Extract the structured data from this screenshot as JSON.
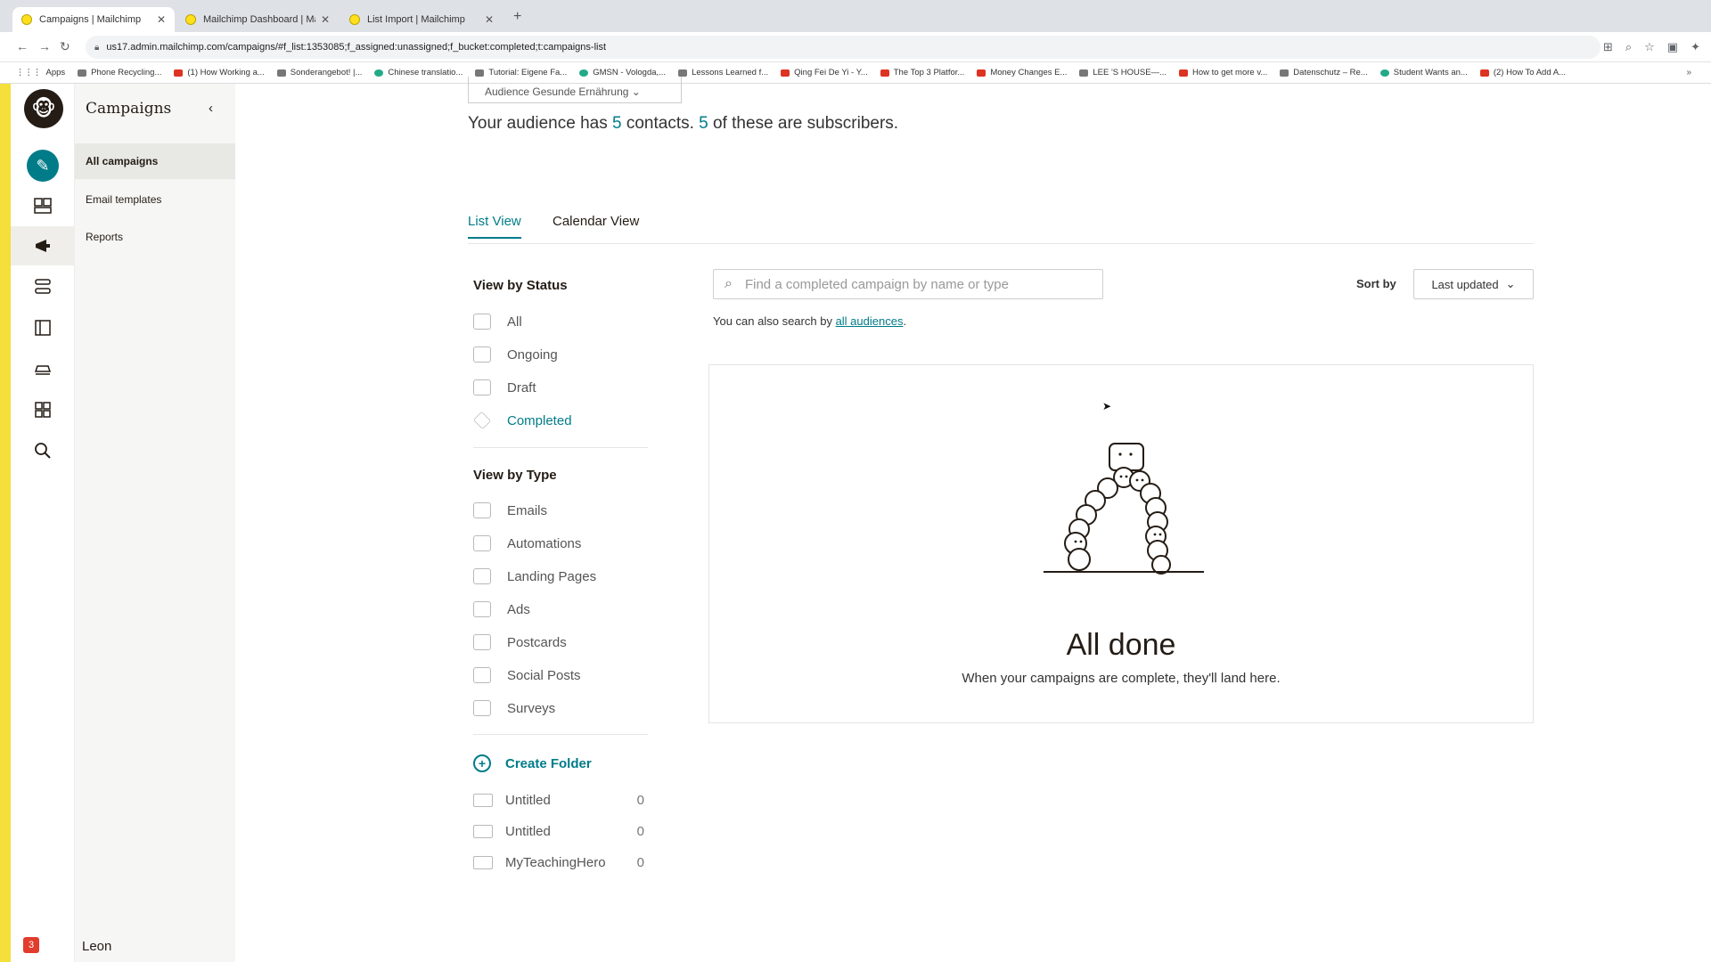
{
  "browser": {
    "tabs": [
      {
        "title": "Campaigns | Mailchimp"
      },
      {
        "title": "Mailchimp Dashboard | Mailchi..."
      },
      {
        "title": "List Import | Mailchimp"
      }
    ],
    "new_tab_icon": "+",
    "url": "us17.admin.mailchimp.com/campaigns/#f_list:1353085;f_assigned:unassigned;f_bucket:completed;t:campaigns-list",
    "bookmarks": [
      "Apps",
      "Phone Recycling...",
      "(1) How Working a...",
      "Sonderangebot! |...",
      "Chinese translatio...",
      "Tutorial: Eigene Fa...",
      "GMSN - Vologda,...",
      "Lessons Learned f...",
      "Qing Fei De Yi - Y...",
      "The Top 3 Platfor...",
      "Money Changes E...",
      "LEE 'S HOUSE—...",
      "How to get more v...",
      "Datenschutz – Re...",
      "Student Wants an...",
      "(2) How To Add A..."
    ]
  },
  "sidebar": {
    "title": "Campaigns",
    "items": [
      {
        "label": "All campaigns"
      },
      {
        "label": "Email templates"
      },
      {
        "label": "Reports"
      }
    ],
    "user_name": "Leon",
    "notification_count": "3"
  },
  "audience": {
    "selector_label": "Audience Gesunde Ernährung",
    "text_prefix": "Your audience has ",
    "contacts": "5",
    "text_mid": " contacts. ",
    "subscribers": "5",
    "text_suffix": " of these are subscribers."
  },
  "view_tabs": [
    {
      "label": "List View"
    },
    {
      "label": "Calendar View"
    }
  ],
  "status_filter": {
    "heading": "View by Status",
    "items": [
      "All",
      "Ongoing",
      "Draft",
      "Completed"
    ],
    "active": "Completed"
  },
  "type_filter": {
    "heading": "View by Type",
    "items": [
      "Emails",
      "Automations",
      "Landing Pages",
      "Ads",
      "Postcards",
      "Social Posts",
      "Surveys"
    ]
  },
  "folders": {
    "create_label": "Create Folder",
    "items": [
      {
        "name": "Untitled",
        "count": "0"
      },
      {
        "name": "Untitled",
        "count": "0"
      },
      {
        "name": "MyTeachingHero",
        "count": "0"
      }
    ]
  },
  "search": {
    "placeholder": "Find a completed campaign by name or type",
    "hint_prefix": "You can also search by ",
    "hint_link": "all audiences",
    "hint_suffix": "."
  },
  "sort": {
    "label": "Sort by",
    "value": "Last updated"
  },
  "empty_state": {
    "title": "All done",
    "subtitle": "When your campaigns are complete, they'll land here."
  },
  "colors": {
    "accent": "#007c89",
    "brand_yellow": "#f5df3a",
    "text": "#241c15"
  }
}
